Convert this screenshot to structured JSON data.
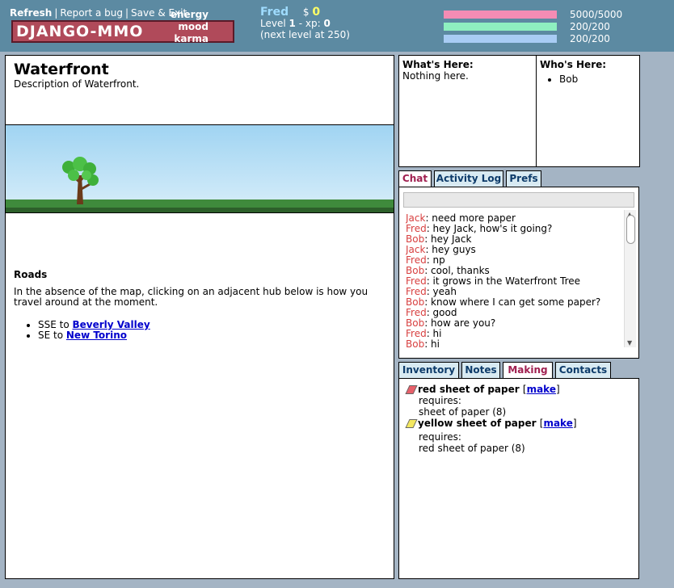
{
  "nav": {
    "refresh": "Refresh",
    "report": "Report a bug",
    "save_exit": "Save & Exit",
    "sep": "|"
  },
  "logo": "DJANGO-MMO",
  "player": {
    "name": "Fred",
    "money_symbol": "$",
    "money": "0",
    "level_label": "Level",
    "level": "1",
    "xp_label": "- xp:",
    "xp": "0",
    "next_level": "(next level at 250)"
  },
  "stats": [
    {
      "label": "energy",
      "value": "5000/5000",
      "fraction": 1.0,
      "color": "#f48cb4"
    },
    {
      "label": "mood",
      "value": "200/200",
      "fraction": 1.0,
      "color": "#8ef0c0"
    },
    {
      "label": "karma",
      "value": "200/200",
      "fraction": 1.0,
      "color": "#a8ccf4"
    }
  ],
  "location": {
    "title": "Waterfront",
    "description": "Description of Waterfront."
  },
  "roads": {
    "title": "Roads",
    "intro": "In the absence of the map, clicking on an adjacent hub below is how you travel around at the moment.",
    "items": [
      {
        "dir": "SSE to",
        "dest": "Beverly Valley"
      },
      {
        "dir": "SE to",
        "dest": "New Torino"
      }
    ]
  },
  "whats_here": {
    "title": "What's Here:",
    "text": "Nothing here."
  },
  "whos_here": {
    "title": "Who's Here:",
    "items": [
      "Bob"
    ]
  },
  "chat_tabs": [
    "Chat",
    "Activity Log",
    "Prefs"
  ],
  "chat": [
    {
      "who": "Jack",
      "msg": ": need more paper"
    },
    {
      "who": "Fred",
      "msg": ": hey Jack, how's it going?"
    },
    {
      "who": "Bob",
      "msg": ": hey Jack"
    },
    {
      "who": "Jack",
      "msg": ": hey guys"
    },
    {
      "who": "Fred",
      "msg": ": np"
    },
    {
      "who": "Bob",
      "msg": ": cool, thanks"
    },
    {
      "who": "Fred",
      "msg": ": it grows in the Waterfront Tree"
    },
    {
      "who": "Fred",
      "msg": ": yeah"
    },
    {
      "who": "Bob",
      "msg": ": know where I can get some paper?"
    },
    {
      "who": "Fred",
      "msg": ": good"
    },
    {
      "who": "Bob",
      "msg": ": how are you?"
    },
    {
      "who": "Fred",
      "msg": ": hi"
    },
    {
      "who": "Bob",
      "msg": ": hi"
    }
  ],
  "making_tabs": [
    "Inventory",
    "Notes",
    "Making",
    "Contacts"
  ],
  "recipes": [
    {
      "name": "red sheet of paper",
      "make": "make",
      "requires": "requires:",
      "ingredient": "sheet of paper (8)",
      "color": "#e8606a"
    },
    {
      "name": "yellow sheet of paper",
      "make": "make",
      "requires": "requires:",
      "ingredient": "red sheet of paper (8)",
      "color": "#f4e860"
    }
  ]
}
